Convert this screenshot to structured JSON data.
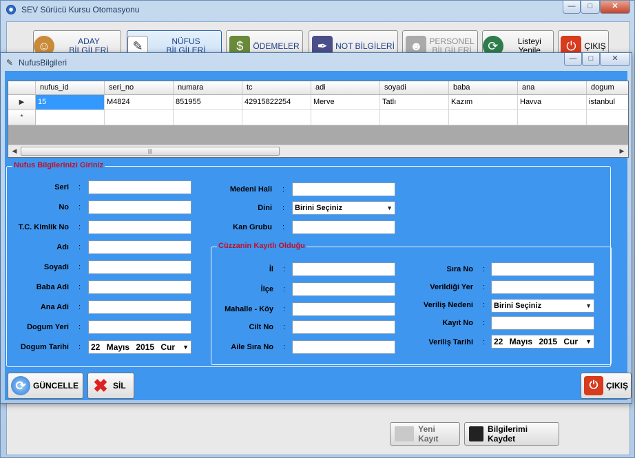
{
  "main_window": {
    "title": "SEV Sürücü Kursu Otomasyonu",
    "caption_buttons": {
      "minimize": "—",
      "maximize": "□",
      "close": "✕"
    }
  },
  "nav": {
    "aday": "ADAY BİLGİLERİ",
    "nufus": "NÜFUS BİLGİLERİ",
    "odemeler": "ÖDEMELER",
    "not": "NOT BİLGİLERİ",
    "personel_1": "PERSONEL",
    "personel_2": "BİLGİLERİ",
    "listeyi_yenile": "Listeyi Yenile",
    "cikis": "ÇIKIŞ"
  },
  "under": {
    "yeni_kayit": "Yeni Kayıt",
    "bilgilerimi_kaydet": "Bilgilerimi Kaydet"
  },
  "child_window": {
    "title": "NufusBilgileri",
    "caption_buttons": {
      "minimize": "—",
      "maximize": "□",
      "close": "✕"
    }
  },
  "grid": {
    "columns": [
      "nufus_id",
      "seri_no",
      "numara",
      "tc",
      "adi",
      "soyadi",
      "baba",
      "ana",
      "dogum"
    ],
    "rows": [
      [
        "15",
        "M4824",
        "851955",
        "42915822254",
        "Merve",
        "Tatlı",
        "Kazım",
        "Havva",
        "istanbul"
      ]
    ],
    "new_row_marker": "*",
    "current_row_marker": "▶",
    "scroll_thumb": "|||",
    "scroll_left": "◀",
    "scroll_right": "▶"
  },
  "nufus_group": {
    "title": "Nufus Bilgilerinizi Giriniz",
    "labels": {
      "seri": "Seri",
      "no": "No",
      "tc": "T.C. Kimlik No",
      "adi": "Adı",
      "soyadi": "Soyadi",
      "baba": "Baba Adi",
      "ana": "Ana Adi",
      "dogum_yeri": "Dogum Yeri",
      "dogum_tarihi": "Dogum Tarihi",
      "medeni": "Medeni Hali",
      "dini": "Dini",
      "kan": "Kan Grubu"
    },
    "colon": ":",
    "dini_value": "Birini Seçiniz",
    "dogum_tarihi_value": "22 Mayıs 2015 Cur"
  },
  "cuzdan_group": {
    "title": "Cüzzanin Kayıtlı Olduğu",
    "labels": {
      "il": "İl",
      "ilce": "İlçe",
      "mahalle": "Mahalle - Köy",
      "cilt": "Cilt No",
      "aile": "Aile Sıra No",
      "sira": "Sıra No",
      "verildigi": "Verildiği Yer",
      "verilis_nedeni": "Veriliş Nedeni",
      "kayit": "Kayıt No",
      "verilis_tarihi": "Veriliş Tarihi"
    },
    "verilis_nedeni_value": "Birini Seçiniz",
    "verilis_tarihi_value": "22 Mayıs 2015 Cur"
  },
  "buttons": {
    "guncelle": "GÜNCELLE",
    "sil": "SİL",
    "cikis": "ÇIKIŞ"
  },
  "colors": {
    "form_bg": "#3f96ee",
    "legend": "#c0102a",
    "selected_cell": "#3399ff"
  }
}
